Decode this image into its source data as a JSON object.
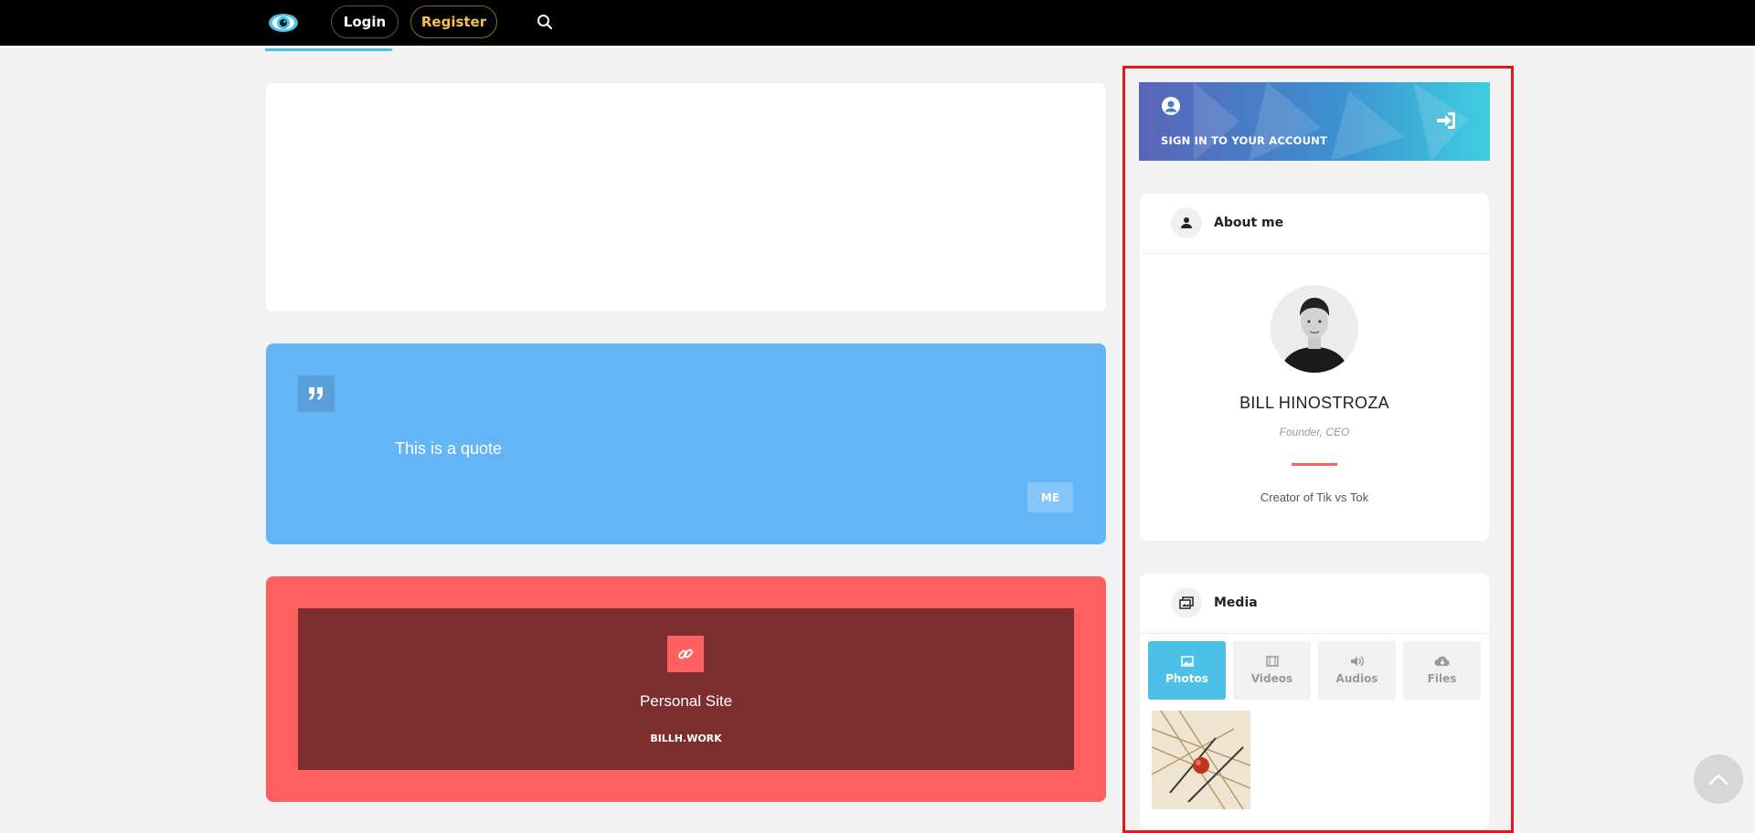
{
  "header": {
    "logo_icon": "eye-logo-icon",
    "login_label": "Login",
    "register_label": "Register",
    "search_icon": "search-icon",
    "colors": {
      "bar": "#000000",
      "accent": "#4cc0e6",
      "register": "#f4c24e"
    }
  },
  "main": {
    "quote": {
      "text": "This is a quote",
      "author": "ME",
      "icon": "quote-icon",
      "color": "#64b5f6"
    },
    "link": {
      "title": "Personal Site",
      "url": "BILLH.WORK",
      "icon": "link-icon",
      "color": "#fe6060"
    }
  },
  "sidebar": {
    "signin": {
      "label": "SIGN IN TO YOUR ACCOUNT",
      "icon": "user-circle-icon",
      "action_icon": "sign-in-arrow-icon"
    },
    "about": {
      "title": "About me",
      "icon": "user-icon",
      "name": "BILL HINOSTROZA",
      "role": "Founder, CEO",
      "bio": "Creator of Tik vs Tok",
      "avatar": "avatar-photo"
    },
    "media": {
      "title": "Media",
      "icon": "media-icon",
      "tabs": [
        {
          "label": "Photos",
          "icon": "image-icon",
          "active": true
        },
        {
          "label": "Videos",
          "icon": "film-icon",
          "active": false
        },
        {
          "label": "Audios",
          "icon": "speaker-icon",
          "active": false
        },
        {
          "label": "Files",
          "icon": "cloud-download-icon",
          "active": false
        }
      ]
    }
  },
  "scroll_top_icon": "chevron-up-icon"
}
